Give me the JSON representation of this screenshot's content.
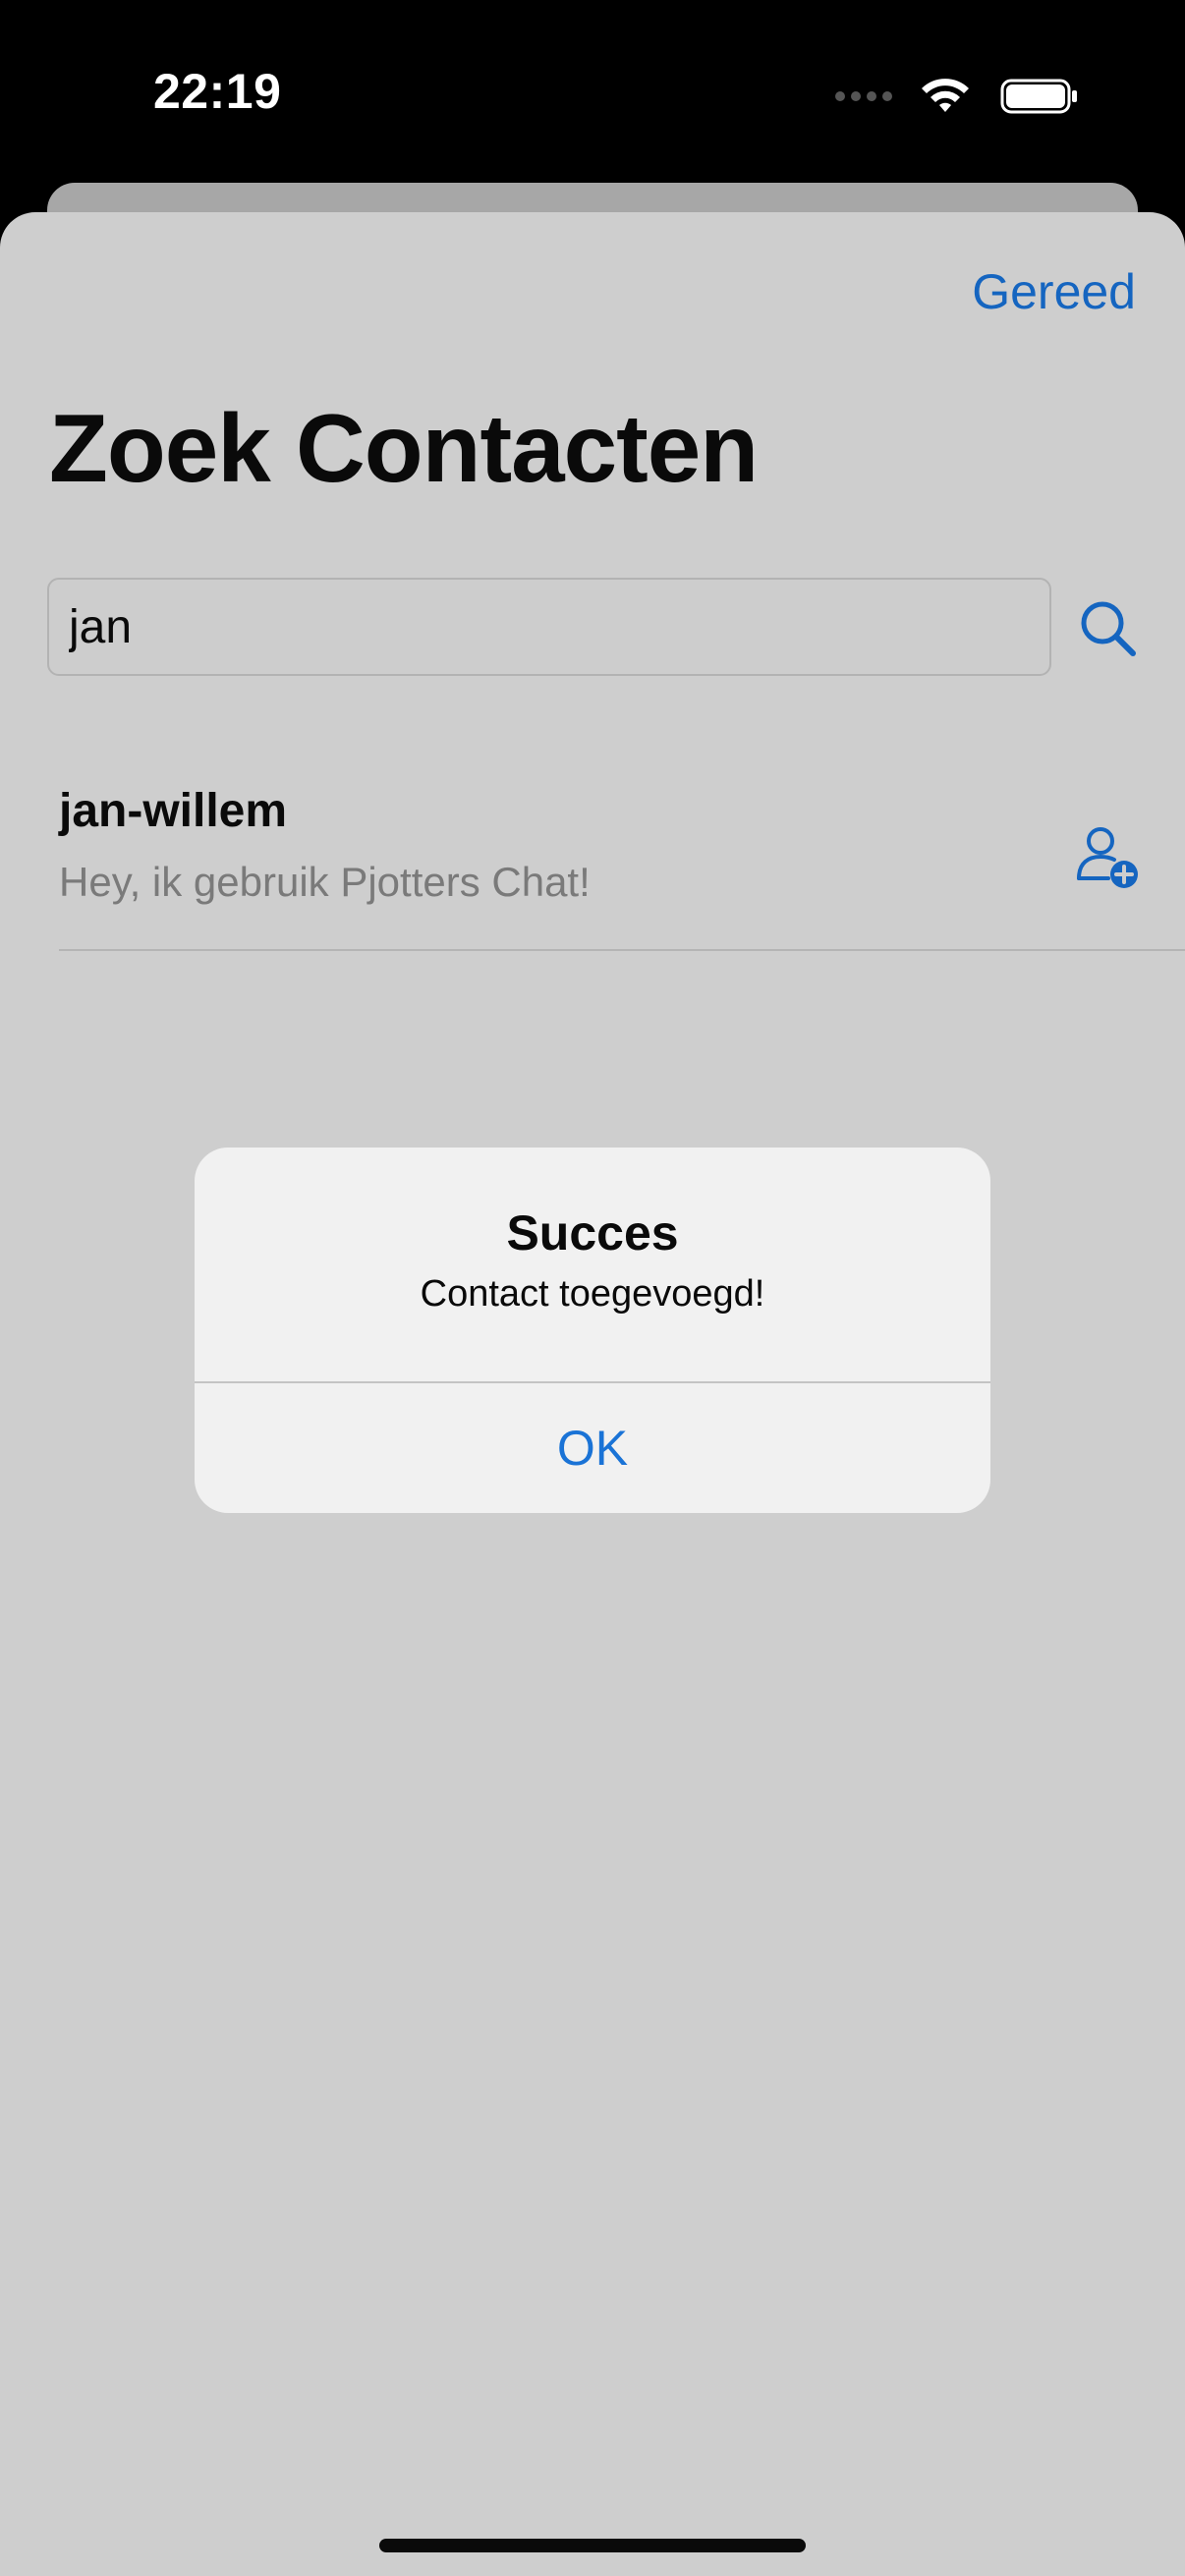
{
  "status_bar": {
    "time": "22:19",
    "icons": [
      "cellular-dots-icon",
      "wifi-icon",
      "battery-icon"
    ]
  },
  "header": {
    "done_label": "Gereed",
    "title": "Zoek Contacten"
  },
  "search": {
    "value": "jan",
    "button_icon": "search-icon"
  },
  "results": [
    {
      "name": "jan-willem",
      "status": "Hey, ik gebruik Pjotters Chat!",
      "action_icon": "person-add-icon"
    }
  ],
  "alert": {
    "title": "Succes",
    "message": "Contact toegevoegd!",
    "ok_label": "OK"
  },
  "colors": {
    "accent": "#1565c0",
    "sheet_background": "#cecece",
    "alert_background": "#f1f1f1"
  }
}
